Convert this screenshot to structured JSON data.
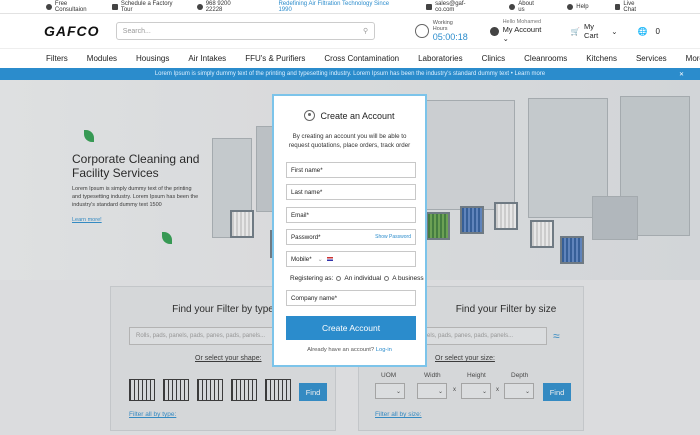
{
  "topbar": {
    "consultation": "Free Consultaion",
    "tour": "Schedule a Factory Tour",
    "phone": "968 9200 22228",
    "tagline": "Redefining Air Filtration Technology Since 1990",
    "email": "sales@gaf-co.com",
    "about": "About us",
    "help": "Help",
    "chat": "Live Chat"
  },
  "header": {
    "logo": "GAFCO",
    "search_placeholder": "Search...",
    "working_hours_label": "Working Hours",
    "working_time": "05:00:18",
    "hello": "Hello Mohamed",
    "account": "My Account",
    "cart": "My Cart",
    "cart_badge": "0"
  },
  "nav": [
    "Filters",
    "Modules",
    "Housings",
    "Air Intakes",
    "FFU's & Purifiers",
    "Cross Contamination",
    "Laboratories",
    "Clinics",
    "Cleanrooms",
    "Kitchens",
    "Services",
    "More ..."
  ],
  "banner": {
    "text": "Lorem Ipsum is simply dummy text of the printing and typesetting industry. Lorem Ipsum has been the industry's standard dummy text • Learn more",
    "close": "✕"
  },
  "hero": {
    "title": "Corporate Cleaning and Facility Services",
    "body": "Lorem Ipsum is simply dummy text of the printing and typesetting industry. Lorem Ipsum has been the industry's standard dummy text 1500",
    "link": "Learn more!"
  },
  "type_card": {
    "title": "Find your Filter by type",
    "placeholder": "Rolls, pads, panels, pads, panes, pads, panels...",
    "or_shape": "Or select your shape:",
    "find": "Find",
    "filter_all": "Filter all by type:"
  },
  "size_card": {
    "title": "Find your Filter by size",
    "placeholder": "Rolls, pads, panels, pads, panes, pads, panels...",
    "or_size": "Or select your size:",
    "uom": "UOM",
    "width": "Width",
    "height": "Height",
    "depth": "Depth",
    "times": "x",
    "find": "Find",
    "filter_all": "Filter all by size:"
  },
  "modal": {
    "title": "Create an Account",
    "description": "By creating an account you will be able to request quotations, place orders, track order",
    "first_name": "First name*",
    "last_name": "Last name*",
    "email": "Email*",
    "password": "Password*",
    "show_password": "Show Password",
    "mobile": "Mobile*",
    "registering_as": "Registering as:",
    "individual": "An individual",
    "business": "A business",
    "company": "Company name*",
    "create": "Create Account",
    "already": "Already have an account?",
    "login": "Log-in"
  },
  "colors": {
    "accent": "#2b8ccc",
    "banner": "#2b8ccc",
    "modal_border": "#7cc4ea"
  }
}
